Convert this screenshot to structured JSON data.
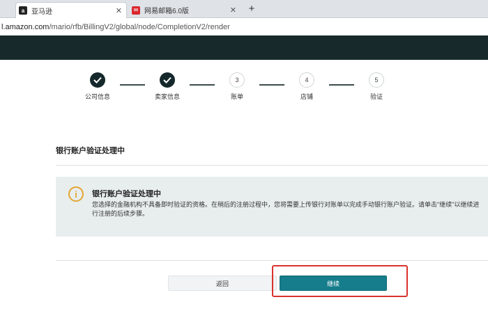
{
  "browser": {
    "tabs": [
      {
        "label": "亚马逊",
        "favicon": "amazon-favicon-icon",
        "active": true
      },
      {
        "label": "网易邮箱6.0版",
        "favicon": "netease-mail-favicon-icon",
        "active": false
      }
    ],
    "new_tab_glyph": "+",
    "close_glyph": "✕",
    "url_host": "l.amazon.com",
    "url_path": "/mario/rfb/BillingV2/global/node/CompletionV2/render"
  },
  "stepper": {
    "steps": [
      {
        "number": "",
        "label": "公司信息",
        "state": "done"
      },
      {
        "number": "",
        "label": "卖家信息",
        "state": "done"
      },
      {
        "number": "3",
        "label": "账单",
        "state": "todo"
      },
      {
        "number": "4",
        "label": "店铺",
        "state": "todo"
      },
      {
        "number": "5",
        "label": "验证",
        "state": "todo"
      }
    ]
  },
  "section": {
    "title": "银行账户验证处理中"
  },
  "alert": {
    "icon": "info-icon",
    "title": "银行账户验证处理中",
    "body": "您选择的金融机构不具备即时验证的资格。在稍后的注册过程中，您将需要上传银行对账单以完成手动银行账户验证。请单击\"继续\"以继续进行注册的后续步骤。"
  },
  "actions": {
    "back_label": "返回",
    "continue_label": "继续"
  },
  "colors": {
    "header_dark": "#17292b",
    "accent_teal": "#157d8b",
    "alert_bg": "#e8eeee",
    "warning_yellow": "#e3a633",
    "highlight_red": "#d9322e"
  }
}
